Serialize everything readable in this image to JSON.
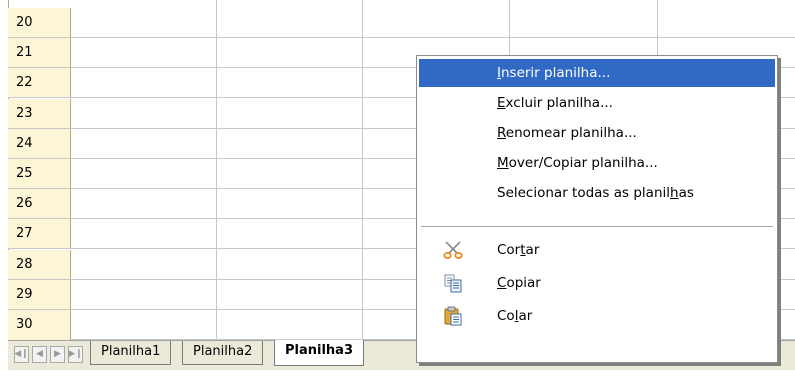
{
  "rows": [
    "20",
    "21",
    "22",
    "23",
    "24",
    "25",
    "26",
    "27",
    "28",
    "29",
    "30"
  ],
  "context_menu": {
    "items": [
      {
        "pre": "",
        "acc": "I",
        "post": "nserir planilha...",
        "highlighted": true
      },
      {
        "pre": "",
        "acc": "E",
        "post": "xcluir planilha..."
      },
      {
        "pre": "",
        "acc": "R",
        "post": "enomear planilha..."
      },
      {
        "pre": "",
        "acc": "M",
        "post": "over/Copiar planilha..."
      },
      {
        "pre": "Selecionar todas as planil",
        "acc": "h",
        "post": "as"
      }
    ],
    "edit_items": [
      {
        "pre": "Cor",
        "acc": "t",
        "post": "ar",
        "icon": "scissors-icon"
      },
      {
        "pre": "",
        "acc": "C",
        "post": "opiar",
        "icon": "copy-icon"
      },
      {
        "pre": "Co",
        "acc": "l",
        "post": "ar",
        "icon": "paste-icon"
      }
    ]
  },
  "tabs": [
    "Planilha1",
    "Planilha2",
    "Planilha3"
  ],
  "colors": {
    "highlight": "#316ac5",
    "row_header": "#fcf5d6"
  }
}
